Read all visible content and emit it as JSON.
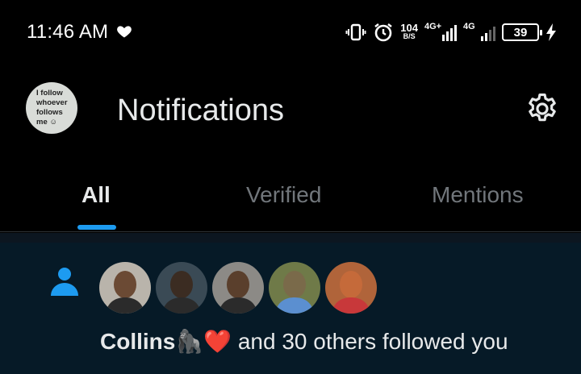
{
  "status_bar": {
    "time": "11:46 AM",
    "net_speed_value": "104",
    "net_speed_unit": "B/S",
    "sim1_label": "4G+",
    "sim2_label": "4G",
    "battery_level": "39"
  },
  "header": {
    "avatar_lines": [
      "I follow",
      "whoever",
      "follows",
      "me ☺"
    ],
    "title": "Notifications"
  },
  "tabs": [
    {
      "label": "All",
      "active": true
    },
    {
      "label": "Verified",
      "active": false
    },
    {
      "label": "Mentions",
      "active": false
    }
  ],
  "notifications": [
    {
      "type": "follow",
      "name": "Collins",
      "emojis": "🦍❤️",
      "text": " and 30 others followed you",
      "faces": [
        "#6b4a34",
        "#3b2c22",
        "#5a3f2c",
        "#7a6a4a",
        "#c56a3a"
      ]
    }
  ],
  "colors": {
    "accent": "#1d9bf0",
    "background": "#000000",
    "notification_bg": "#061a27"
  }
}
